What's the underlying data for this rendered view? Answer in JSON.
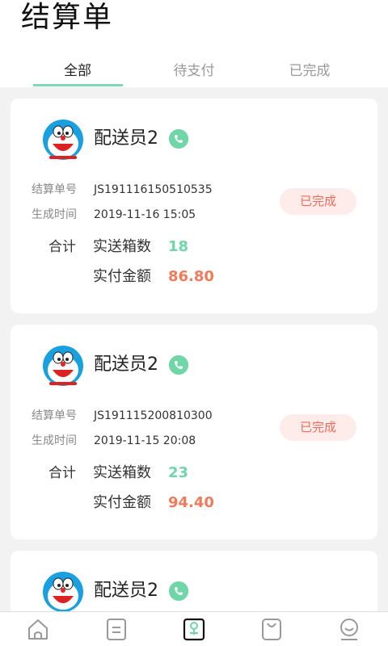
{
  "header": {
    "title": "结算单"
  },
  "tabs": [
    {
      "label": "全部",
      "active": true
    },
    {
      "label": "待支付",
      "active": false
    },
    {
      "label": "已完成",
      "active": false
    }
  ],
  "labels": {
    "order_no": "结算单号",
    "created_at": "生成时间",
    "sum": "合计",
    "boxes": "实送箱数",
    "amount": "实付金额"
  },
  "orders": [
    {
      "rider": "配送员2",
      "order_no": "JS191116150510535",
      "created_at": "2019-11-16 15:05",
      "status": "已完成",
      "boxes": "18",
      "amount": "86.80"
    },
    {
      "rider": "配送员2",
      "order_no": "JS191115200810300",
      "created_at": "2019-11-15 20:08",
      "status": "已完成",
      "boxes": "23",
      "amount": "94.40"
    },
    {
      "rider": "配送员2"
    }
  ],
  "tabbar": [
    {
      "icon": "home-icon",
      "active": false
    },
    {
      "icon": "document-icon",
      "active": false
    },
    {
      "icon": "settlement-icon",
      "active": true
    },
    {
      "icon": "bag-icon",
      "active": false
    },
    {
      "icon": "profile-icon",
      "active": false
    }
  ],
  "colors": {
    "accent": "#6fd6a8",
    "status_bg": "#fdecea",
    "status_text": "#f06a5a",
    "amount": "#f07a5a"
  }
}
